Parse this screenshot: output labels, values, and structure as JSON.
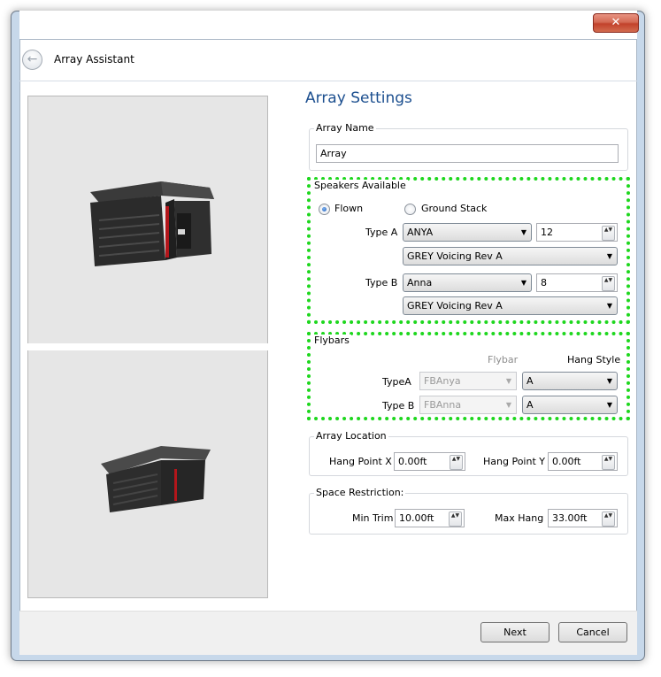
{
  "window": {
    "title": "Array Assistant",
    "close_glyph": "✕"
  },
  "header": {
    "back_icon": "back-arrow-icon",
    "back_glyph": "←"
  },
  "settings": {
    "heading": "Array Settings",
    "array_name": {
      "label": "Array Name",
      "value": "Array"
    },
    "speakers": {
      "label": "Speakers Available",
      "radio_flown": "Flown",
      "radio_ground": "Ground Stack",
      "selected": "Flown",
      "type_a": {
        "label": "Type A",
        "model": "ANYA",
        "count": "12",
        "voicing": "GREY Voicing Rev A"
      },
      "type_b": {
        "label": "Type B",
        "model": "Anna",
        "count": "8",
        "voicing": "GREY Voicing Rev A"
      }
    },
    "flybars": {
      "label": "Flybars",
      "col_flybar": "Flybar",
      "col_hang_style": "Hang Style",
      "rows": [
        {
          "label": "TypeA",
          "flybar": "FBAnya",
          "hang_style": "A"
        },
        {
          "label": "Type B",
          "flybar": "FBAnna",
          "hang_style": "A"
        }
      ]
    },
    "location": {
      "label": "Array Location",
      "x_label": "Hang Point X",
      "x_value": "0.00ft",
      "y_label": "Hang Point Y",
      "y_value": "0.00ft"
    },
    "restriction": {
      "label": "Space Restriction:",
      "min_trim_label": "Min Trim",
      "min_trim_value": "10.00ft",
      "max_hang_label": "Max Hang",
      "max_hang_value": "33.00ft"
    }
  },
  "footer": {
    "next_label": "Next",
    "cancel_label": "Cancel"
  },
  "glyphs": {
    "dropdown": "▼",
    "spin": "▲▼"
  },
  "colors": {
    "heading": "#1c4f8f",
    "focus_outline": "#1ed71e",
    "close_button": "#c2412b"
  }
}
